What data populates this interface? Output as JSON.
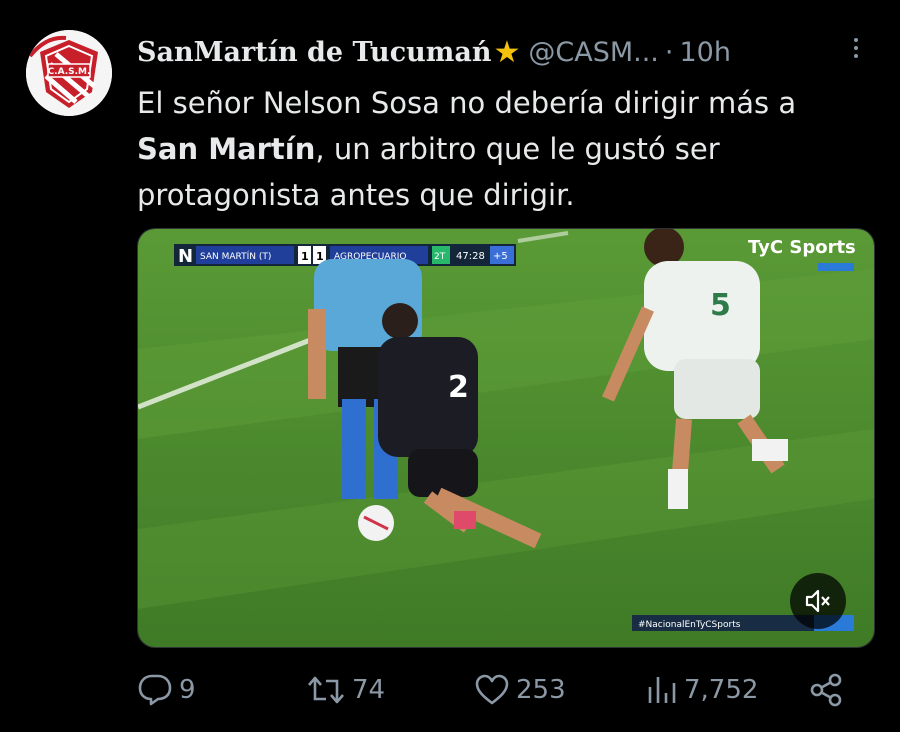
{
  "author": {
    "display_name": "SanMartín de Tucumań",
    "verified_icon": "star",
    "handle": "@CASM...",
    "separator": "·",
    "time_ago": "10h"
  },
  "tweet": {
    "text_part1": "El señor Nelson Sosa no debería dirigir más a",
    "text_bold": "San Martín",
    "text_part2": ", un arbitro que le gustó ser protagonista antes que dirigir."
  },
  "avatar": {
    "label": "C.A.S.M."
  },
  "video": {
    "scoreboard": {
      "channel_logo": "N",
      "home_team": "SAN MARTÍN (T)",
      "home_score": "1",
      "away_score": "1",
      "away_team": "AGROPECUARIO",
      "period": "2T",
      "clock": "47:28",
      "added_time": "+5"
    },
    "broadcaster": "TyC Sports",
    "hashtag": "#NacionalEnTyCSports",
    "player_numbers": {
      "dark_player": "2",
      "white_player": "5"
    },
    "muted": true
  },
  "actions": {
    "replies": "9",
    "reposts": "74",
    "likes": "253",
    "views": "7,752"
  },
  "colors": {
    "background": "#000000",
    "text": "#e7e9ea",
    "secondary": "#8b98a5",
    "verified_star": "#f4c20d",
    "pitch": "#4f8a2e"
  }
}
